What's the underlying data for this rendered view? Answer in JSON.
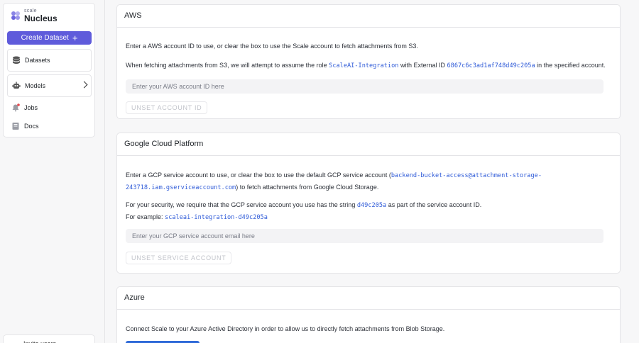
{
  "sidebar": {
    "logo_small": "scale",
    "logo_big": "Nucleus",
    "create_label": "Create Dataset",
    "items": [
      {
        "label": "Datasets",
        "icon": "database-icon"
      },
      {
        "label": "Models",
        "icon": "robot-icon"
      },
      {
        "label": "Jobs",
        "icon": "bell-icon"
      },
      {
        "label": "Docs",
        "icon": "book-icon"
      }
    ],
    "invite_label": "Invite users"
  },
  "aws": {
    "title": "AWS",
    "line1": "Enter a AWS account ID to use, or clear the box to use the Scale account to fetch attachments from S3.",
    "line2_pre": "When fetching attachments from S3, we will attempt to assume the role ",
    "role": "ScaleAI-Integration",
    "line2_mid": " with External ID ",
    "external_id": "6867c6c3ad1af748d49c205a",
    "line2_post": " in the specified account.",
    "placeholder": "Enter your AWS account ID here",
    "unset_label": "UNSET ACCOUNT ID"
  },
  "gcp": {
    "title": "Google Cloud Platform",
    "line1_pre": "Enter a GCP service account to use, or clear the box to use the default GCP service account (",
    "service_account_part1": "backend-bucket-access@attachment-storage-",
    "service_account_part2": "243718.iam.gserviceaccount.com",
    "line1_post": ") to fetch attachments from Google Cloud Storage.",
    "line3_pre": "For your security, we require that the GCP service account you use has the string ",
    "required_string": "d49c205a",
    "line3_post": " as part of the service account ID.",
    "example_label": "For example: ",
    "example_value": "scaleai-integration-d49c205a",
    "placeholder": "Enter your GCP service account email here",
    "unset_label": "UNSET SERVICE ACCOUNT"
  },
  "azure": {
    "title": "Azure",
    "line1": "Connect Scale to your Azure Active Directory in order to allow us to directly fetch attachments from Blob Storage."
  },
  "colors": {
    "accent": "#5f5bdb",
    "code": "#2f5bd8",
    "azure_button": "#2f6ad8"
  }
}
